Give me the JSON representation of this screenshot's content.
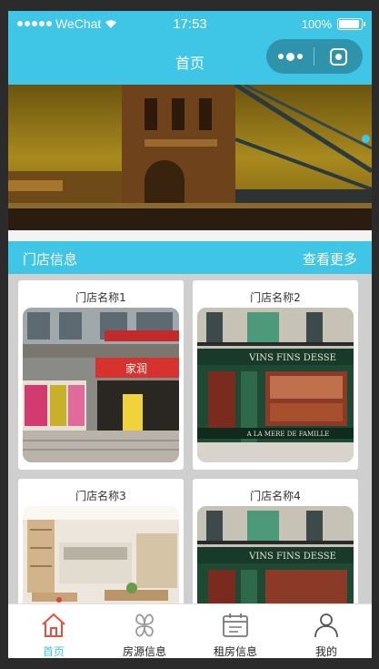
{
  "status_bar": {
    "carrier": "WeChat",
    "time": "17:53",
    "battery": "100%",
    "battery_level": 1.0
  },
  "nav": {
    "title": "首页"
  },
  "banner": {
    "active_index": 0
  },
  "section": {
    "title": "门店信息",
    "more": "查看更多"
  },
  "stores": [
    {
      "name": "门店名称1",
      "sign": "家润"
    },
    {
      "name": "门店名称2",
      "sign": "VINS FINS DESSE",
      "sign2": "A LA MERE DE FAMILLE"
    },
    {
      "name": "门店名称3"
    },
    {
      "name": "门店名称4",
      "sign": "VINS FINS DESSE"
    }
  ],
  "tabs": [
    {
      "label": "首页",
      "icon": "home-icon",
      "active": true
    },
    {
      "label": "房源信息",
      "icon": "clover-icon",
      "active": false
    },
    {
      "label": "租房信息",
      "icon": "calendar-icon",
      "active": false
    },
    {
      "label": "我的",
      "icon": "person-icon",
      "active": false
    }
  ],
  "colors": {
    "accent": "#3fc6e6",
    "tab_active": "#e84d3d"
  }
}
